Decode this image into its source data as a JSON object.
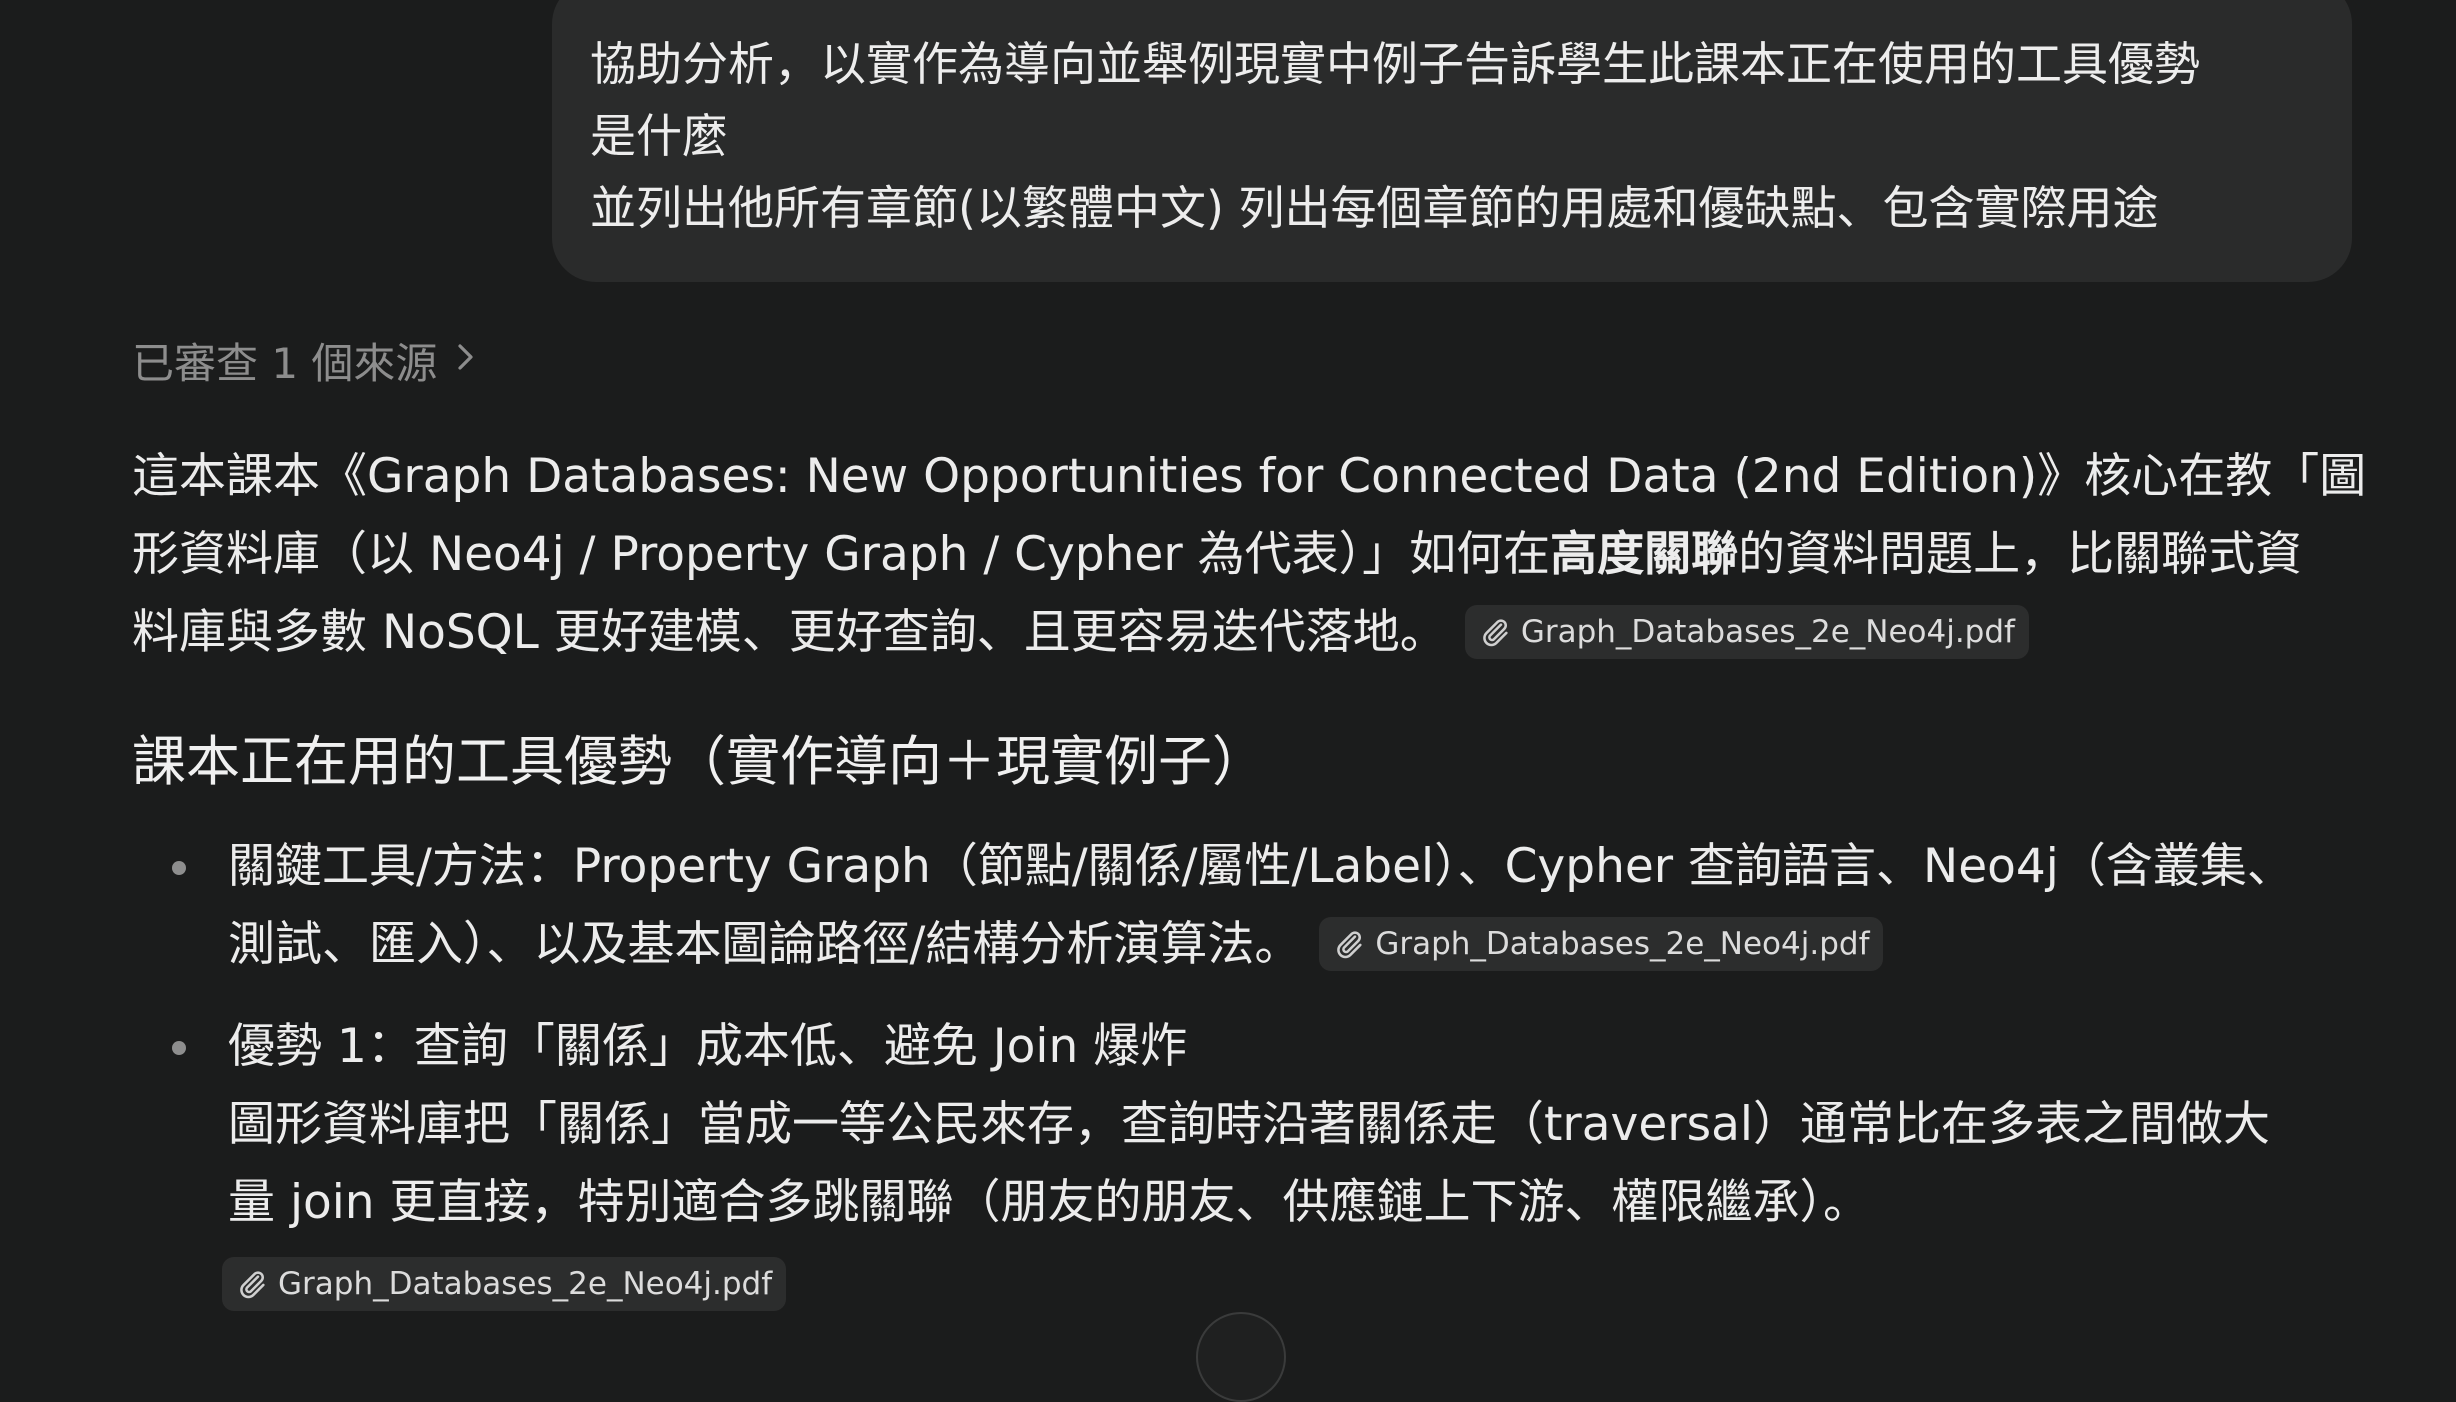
{
  "user_message": {
    "lines": [
      "協助分析，以實作為導向並舉例現實中例子告訴學生此課本正在使用的工具優勢",
      "是什麼",
      "並列出他所有章節(以繁體中文) 列出每個章節的用處和優缺點、包含實際用途"
    ]
  },
  "sources": {
    "label": "已審查 1 個來源",
    "icon": "chevron-right-icon"
  },
  "answer": {
    "intro": {
      "line1": "這本課本《Graph Databases: New Opportunities for Connected Data (2nd Edition)》核心在教「圖",
      "line2_prefix": "形資料庫（以 Neo4j / Property Graph / Cypher 為代表）」如何在",
      "line2_bold": "高度關聯",
      "line2_suffix": "的資料問題上，比關聯式資",
      "line3": "料庫與多數 NoSQL 更好建模、更好查詢、且更容易迭代落地。",
      "citation": "Graph_Databases_2e_Neo4j.pdf"
    },
    "heading": "課本正在用的工具優勢（實作導向＋現實例子）",
    "bullets": [
      {
        "line1": "關鍵工具/方法：Property Graph（節點/關係/屬性/Label）、Cypher 查詢語言、Neo4j（含叢集、",
        "line2": "測試、匯入）、以及基本圖論路徑/結構分析演算法。",
        "citation": "Graph_Databases_2e_Neo4j.pdf"
      },
      {
        "line1": "優勢 1：查詢「關係」成本低、避免 Join 爆炸",
        "line2": "圖形資料庫把「關係」當成一等公民來存，查詢時沿著關係走（traversal）通常比在多表之間做大",
        "line3": "量 join 更直接，特別適合多跳關聯（朋友的朋友、供應鏈上下游、權限繼承）。",
        "citation": "Graph_Databases_2e_Neo4j.pdf"
      }
    ]
  },
  "icons": {
    "citation": "paperclip-icon",
    "scroll": "scroll-down-icon"
  },
  "colors": {
    "background": "#1b1c1c",
    "bubble": "#2a2b2b",
    "chip": "#2c2d2d",
    "muted": "#8d8d8d"
  }
}
